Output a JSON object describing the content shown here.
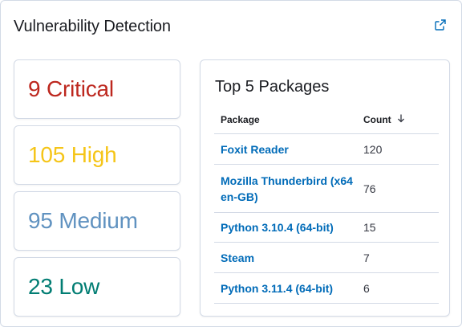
{
  "panel": {
    "title": "Vulnerability Detection",
    "external_link_icon": "external-link-icon"
  },
  "severity_cards": [
    {
      "label": "9 Critical",
      "color": "#bd271e"
    },
    {
      "label": "105 High",
      "color": "#f5c518"
    },
    {
      "label": "95 Medium",
      "color": "#6092c0"
    },
    {
      "label": "23 Low",
      "color": "#017d73"
    }
  ],
  "top_packages": {
    "title": "Top 5 Packages",
    "columns": {
      "package": "Package",
      "count": "Count"
    },
    "sort_icon": "arrow-down-icon",
    "rows": [
      {
        "package": "Foxit Reader",
        "count": "120"
      },
      {
        "package": "Mozilla Thunderbird (x64 en-GB)",
        "count": "76"
      },
      {
        "package": "Python 3.10.4 (64-bit)",
        "count": "15"
      },
      {
        "package": "Steam",
        "count": "7"
      },
      {
        "package": "Python 3.11.4 (64-bit)",
        "count": "6"
      }
    ]
  }
}
